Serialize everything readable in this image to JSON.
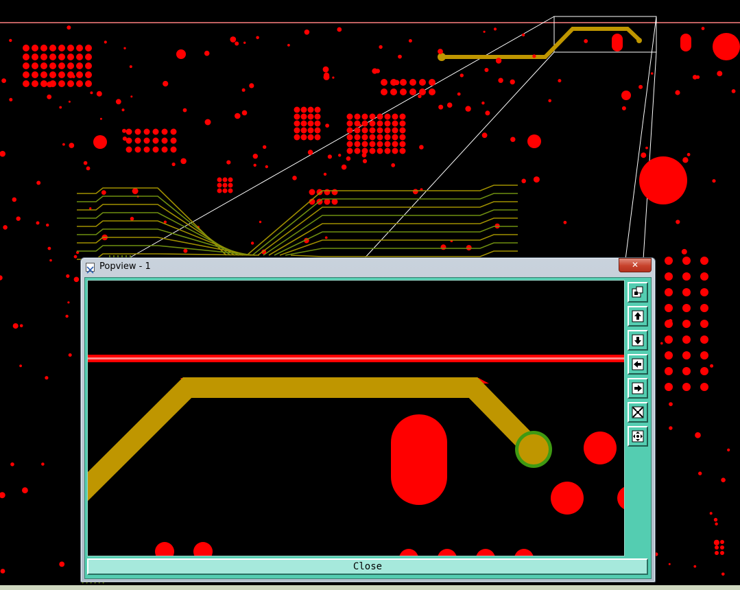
{
  "window": {
    "title": "Popview - 1",
    "close_glyph": "✕",
    "close_button_label": "Close"
  },
  "toolbar": {
    "buttons": [
      {
        "icon": "zoom-window-icon",
        "tooltip": ""
      },
      {
        "icon": "pan-up-icon",
        "tooltip": ""
      },
      {
        "icon": "pan-down-icon",
        "tooltip": ""
      },
      {
        "icon": "pan-left-icon",
        "tooltip": ""
      },
      {
        "icon": "pan-right-icon",
        "tooltip": ""
      },
      {
        "icon": "zoom-fit-icon",
        "tooltip": ""
      },
      {
        "icon": "zoom-all-icon",
        "tooltip": ""
      }
    ]
  },
  "colors": {
    "pad_red": "#ff0000",
    "trace_gold": "#bf9600",
    "trace_green": "#6f8f10",
    "board_bg": "#000000",
    "panel_teal": "#54cdb1"
  }
}
